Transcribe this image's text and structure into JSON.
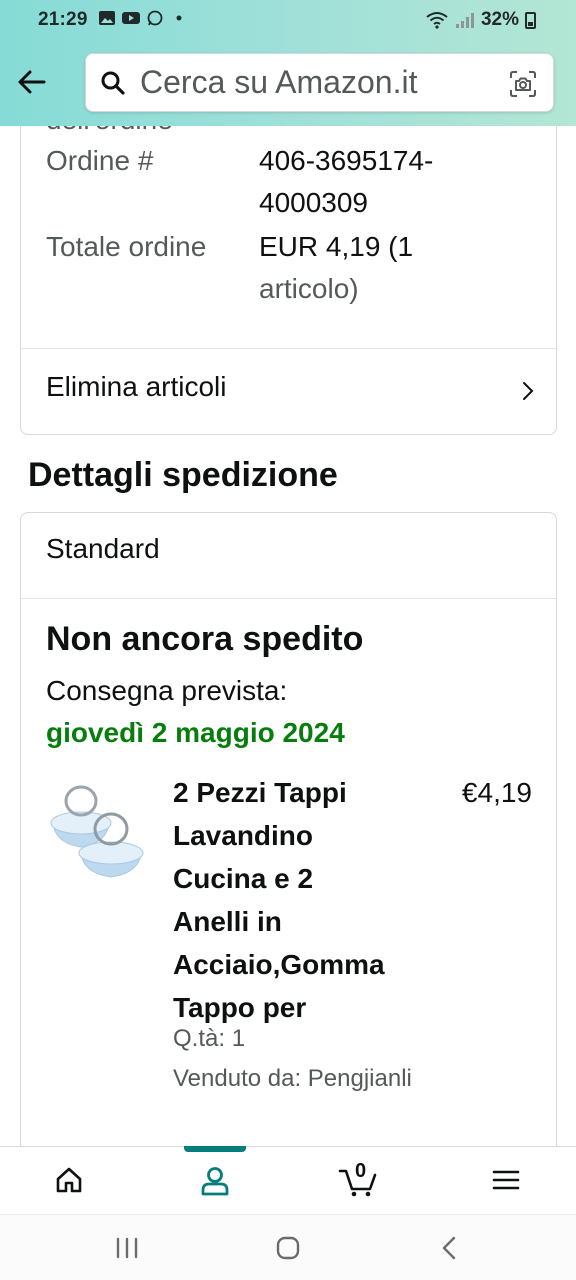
{
  "status_bar": {
    "time": "21:29",
    "battery": "32%",
    "notification_icons": [
      "gallery-icon",
      "youtube-icon",
      "whatsapp-icon",
      "dot-icon"
    ],
    "system_icons": [
      "wifi-icon",
      "signal-icon",
      "battery-icon"
    ]
  },
  "header": {
    "search_placeholder": "Cerca su Amazon.it",
    "accent": "#86dbd6"
  },
  "order_summary": {
    "cut_label": "dell'ordine",
    "order_number_label": "Ordine #",
    "order_number_line1": "406-3695174-",
    "order_number_line2": "4000309",
    "total_label": "Totale ordine",
    "total_value_line1": "EUR 4,19 (1",
    "total_value_line2": "articolo)",
    "delete_items_label": "Elimina articoli"
  },
  "shipping": {
    "section_title": "Dettagli spedizione",
    "type": "Standard",
    "status": "Non ancora spedito",
    "delivery_label": "Consegna prevista:",
    "delivery_date": "giovedì 2 maggio 2024",
    "delivery_date_color": "#067d0c",
    "item": {
      "title_lines": [
        "2 Pezzi Tappi",
        "Lavandino",
        "Cucina e 2",
        "Anelli in",
        "Acciaio,Gomma",
        "Tappo per"
      ],
      "price": "€4,19",
      "quantity": "Q.tà: 1",
      "seller": "Venduto da: Pengjianli"
    }
  },
  "bottom_nav": {
    "items": [
      "home-icon",
      "account-icon",
      "cart-icon",
      "menu-icon"
    ],
    "cart_count": "0",
    "active": "account-icon",
    "active_color": "#067d7d"
  },
  "system_nav": [
    "recent-apps-icon",
    "home-button-icon",
    "back-icon"
  ]
}
